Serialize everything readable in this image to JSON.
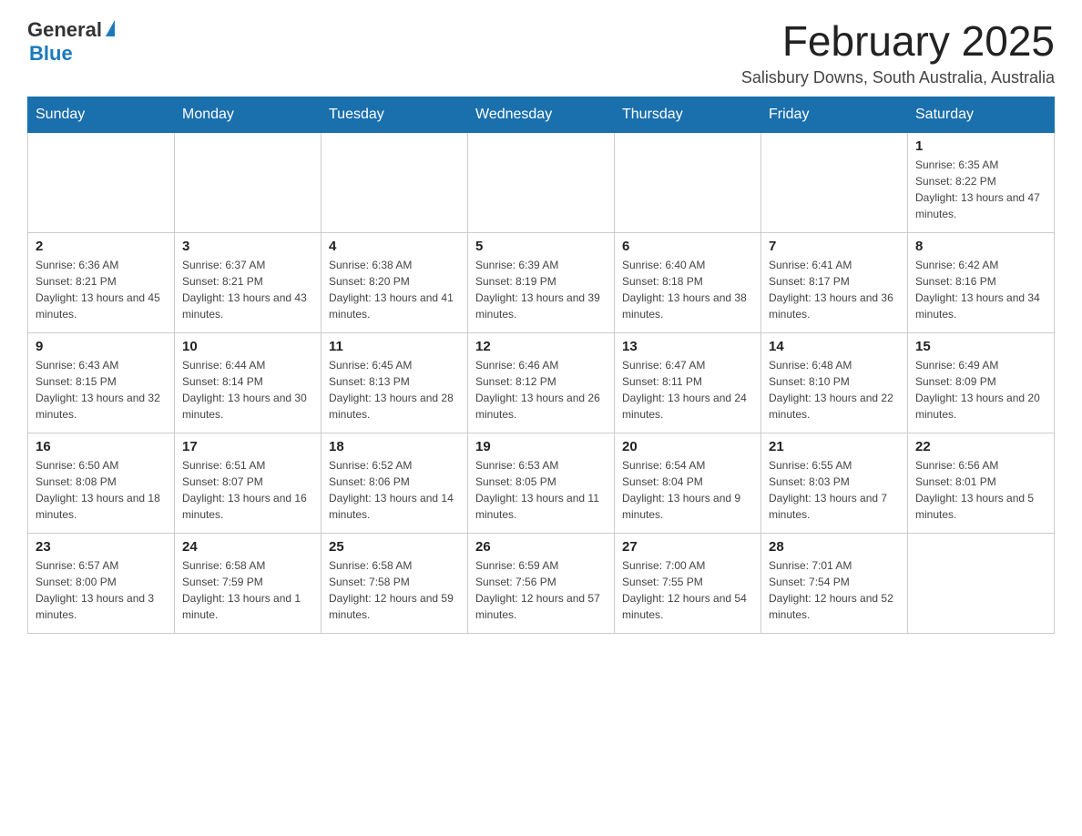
{
  "header": {
    "logo_general": "General",
    "logo_blue": "Blue",
    "title": "February 2025",
    "subtitle": "Salisbury Downs, South Australia, Australia"
  },
  "weekdays": [
    "Sunday",
    "Monday",
    "Tuesday",
    "Wednesday",
    "Thursday",
    "Friday",
    "Saturday"
  ],
  "weeks": [
    [
      {
        "day": "",
        "info": ""
      },
      {
        "day": "",
        "info": ""
      },
      {
        "day": "",
        "info": ""
      },
      {
        "day": "",
        "info": ""
      },
      {
        "day": "",
        "info": ""
      },
      {
        "day": "",
        "info": ""
      },
      {
        "day": "1",
        "info": "Sunrise: 6:35 AM\nSunset: 8:22 PM\nDaylight: 13 hours and 47 minutes."
      }
    ],
    [
      {
        "day": "2",
        "info": "Sunrise: 6:36 AM\nSunset: 8:21 PM\nDaylight: 13 hours and 45 minutes."
      },
      {
        "day": "3",
        "info": "Sunrise: 6:37 AM\nSunset: 8:21 PM\nDaylight: 13 hours and 43 minutes."
      },
      {
        "day": "4",
        "info": "Sunrise: 6:38 AM\nSunset: 8:20 PM\nDaylight: 13 hours and 41 minutes."
      },
      {
        "day": "5",
        "info": "Sunrise: 6:39 AM\nSunset: 8:19 PM\nDaylight: 13 hours and 39 minutes."
      },
      {
        "day": "6",
        "info": "Sunrise: 6:40 AM\nSunset: 8:18 PM\nDaylight: 13 hours and 38 minutes."
      },
      {
        "day": "7",
        "info": "Sunrise: 6:41 AM\nSunset: 8:17 PM\nDaylight: 13 hours and 36 minutes."
      },
      {
        "day": "8",
        "info": "Sunrise: 6:42 AM\nSunset: 8:16 PM\nDaylight: 13 hours and 34 minutes."
      }
    ],
    [
      {
        "day": "9",
        "info": "Sunrise: 6:43 AM\nSunset: 8:15 PM\nDaylight: 13 hours and 32 minutes."
      },
      {
        "day": "10",
        "info": "Sunrise: 6:44 AM\nSunset: 8:14 PM\nDaylight: 13 hours and 30 minutes."
      },
      {
        "day": "11",
        "info": "Sunrise: 6:45 AM\nSunset: 8:13 PM\nDaylight: 13 hours and 28 minutes."
      },
      {
        "day": "12",
        "info": "Sunrise: 6:46 AM\nSunset: 8:12 PM\nDaylight: 13 hours and 26 minutes."
      },
      {
        "day": "13",
        "info": "Sunrise: 6:47 AM\nSunset: 8:11 PM\nDaylight: 13 hours and 24 minutes."
      },
      {
        "day": "14",
        "info": "Sunrise: 6:48 AM\nSunset: 8:10 PM\nDaylight: 13 hours and 22 minutes."
      },
      {
        "day": "15",
        "info": "Sunrise: 6:49 AM\nSunset: 8:09 PM\nDaylight: 13 hours and 20 minutes."
      }
    ],
    [
      {
        "day": "16",
        "info": "Sunrise: 6:50 AM\nSunset: 8:08 PM\nDaylight: 13 hours and 18 minutes."
      },
      {
        "day": "17",
        "info": "Sunrise: 6:51 AM\nSunset: 8:07 PM\nDaylight: 13 hours and 16 minutes."
      },
      {
        "day": "18",
        "info": "Sunrise: 6:52 AM\nSunset: 8:06 PM\nDaylight: 13 hours and 14 minutes."
      },
      {
        "day": "19",
        "info": "Sunrise: 6:53 AM\nSunset: 8:05 PM\nDaylight: 13 hours and 11 minutes."
      },
      {
        "day": "20",
        "info": "Sunrise: 6:54 AM\nSunset: 8:04 PM\nDaylight: 13 hours and 9 minutes."
      },
      {
        "day": "21",
        "info": "Sunrise: 6:55 AM\nSunset: 8:03 PM\nDaylight: 13 hours and 7 minutes."
      },
      {
        "day": "22",
        "info": "Sunrise: 6:56 AM\nSunset: 8:01 PM\nDaylight: 13 hours and 5 minutes."
      }
    ],
    [
      {
        "day": "23",
        "info": "Sunrise: 6:57 AM\nSunset: 8:00 PM\nDaylight: 13 hours and 3 minutes."
      },
      {
        "day": "24",
        "info": "Sunrise: 6:58 AM\nSunset: 7:59 PM\nDaylight: 13 hours and 1 minute."
      },
      {
        "day": "25",
        "info": "Sunrise: 6:58 AM\nSunset: 7:58 PM\nDaylight: 12 hours and 59 minutes."
      },
      {
        "day": "26",
        "info": "Sunrise: 6:59 AM\nSunset: 7:56 PM\nDaylight: 12 hours and 57 minutes."
      },
      {
        "day": "27",
        "info": "Sunrise: 7:00 AM\nSunset: 7:55 PM\nDaylight: 12 hours and 54 minutes."
      },
      {
        "day": "28",
        "info": "Sunrise: 7:01 AM\nSunset: 7:54 PM\nDaylight: 12 hours and 52 minutes."
      },
      {
        "day": "",
        "info": ""
      }
    ]
  ]
}
